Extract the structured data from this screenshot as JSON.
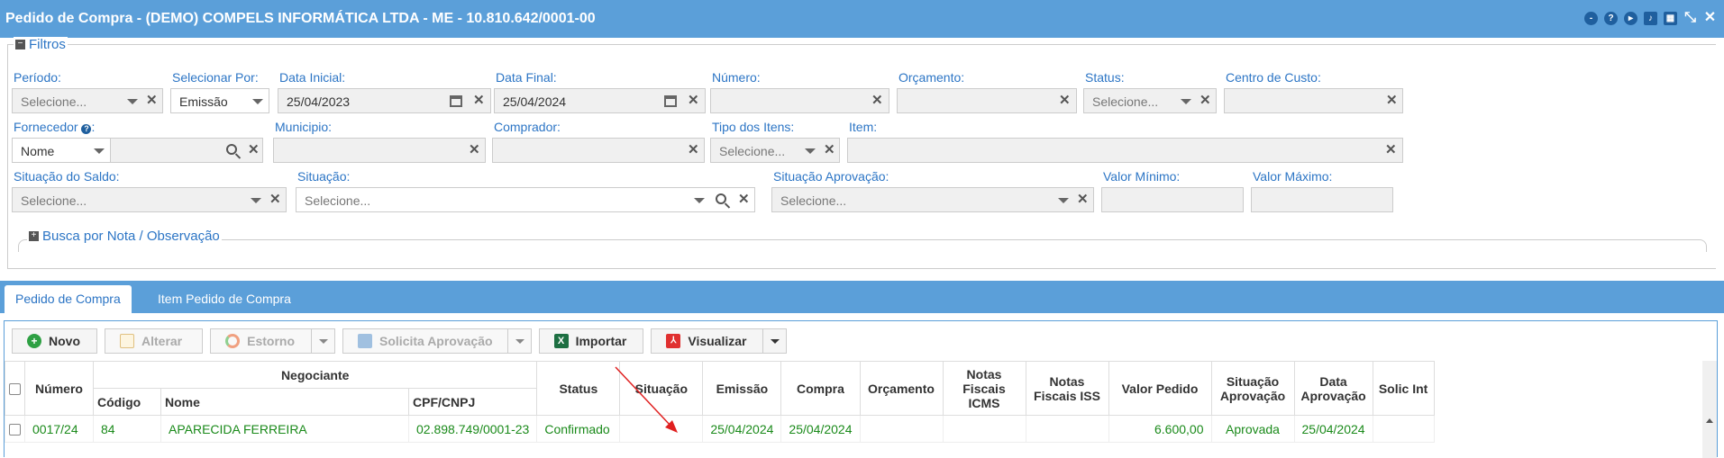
{
  "window": {
    "title": "Pedido de Compra - (DEMO) COMPELS INFORMÁTICA LTDA - ME - 10.810.642/0001-00"
  },
  "filters": {
    "legend": "Filtros",
    "periodo": {
      "label": "Período:",
      "value": "Selecione..."
    },
    "selecionar_por": {
      "label": "Selecionar Por:",
      "value": "Emissão"
    },
    "data_inicial": {
      "label": "Data Inicial:",
      "value": "25/04/2023"
    },
    "data_final": {
      "label": "Data Final:",
      "value": "25/04/2024"
    },
    "numero": {
      "label": "Número:",
      "value": ""
    },
    "orcamento": {
      "label": "Orçamento:",
      "value": ""
    },
    "status": {
      "label": "Status:",
      "value": "Selecione..."
    },
    "centro_custo": {
      "label": "Centro de Custo:",
      "value": ""
    },
    "fornecedor": {
      "label": "Fornecedor",
      "type": "Nome",
      "value": ""
    },
    "municipio": {
      "label": "Municipio:",
      "value": ""
    },
    "comprador": {
      "label": "Comprador:",
      "value": ""
    },
    "tipo_itens": {
      "label": "Tipo dos Itens:",
      "value": "Selecione..."
    },
    "item": {
      "label": "Item:",
      "value": ""
    },
    "situacao_saldo": {
      "label": "Situação do Saldo:",
      "value": "Selecione..."
    },
    "situacao": {
      "label": "Situação:",
      "value": "Selecione..."
    },
    "situacao_aprovacao": {
      "label": "Situação Aprovação:",
      "value": "Selecione..."
    },
    "valor_minimo": {
      "label": "Valor Mínimo:",
      "value": ""
    },
    "valor_maximo": {
      "label": "Valor Máximo:",
      "value": ""
    },
    "busca": "Busca por Nota / Observação"
  },
  "tabs": [
    {
      "label": "Pedido de Compra"
    },
    {
      "label": "Item Pedido de Compra"
    }
  ],
  "toolbar": {
    "novo": "Novo",
    "alterar": "Alterar",
    "estorno": "Estorno",
    "solicita": "Solicita Aprovação",
    "importar": "Importar",
    "visualizar": "Visualizar"
  },
  "table": {
    "headers": {
      "numero": "Número",
      "negociante": "Negociante",
      "codigo": "Código",
      "nome": "Nome",
      "cpf": "CPF/CNPJ",
      "status": "Status",
      "situacao": "Situação",
      "emissao": "Emissão",
      "compra": "Compra",
      "orcamento": "Orçamento",
      "nf_icms": "Notas Fiscais ICMS",
      "nf_iss": "Notas Fiscais ISS",
      "valor": "Valor Pedido",
      "sit_aprov": "Situação Aprovação",
      "data_aprov": "Data Aprovação",
      "solic": "Solic Int"
    },
    "rows": [
      {
        "numero": "0017/24",
        "codigo": "84",
        "nome": "APARECIDA FERREIRA",
        "cpf": "02.898.749/0001-23",
        "status": "Confirmado",
        "situacao": "",
        "emissao": "25/04/2024",
        "compra": "25/04/2024",
        "orcamento": "",
        "nf_icms": "",
        "nf_iss": "",
        "valor": "6.600,00",
        "sit_aprov": "Aprovada",
        "data_aprov": "25/04/2024"
      }
    ]
  },
  "colors": {
    "header": "#5b9fd9",
    "label": "#2c75c5",
    "row_text": "#1a8a1a",
    "arrow": "#e02020"
  }
}
